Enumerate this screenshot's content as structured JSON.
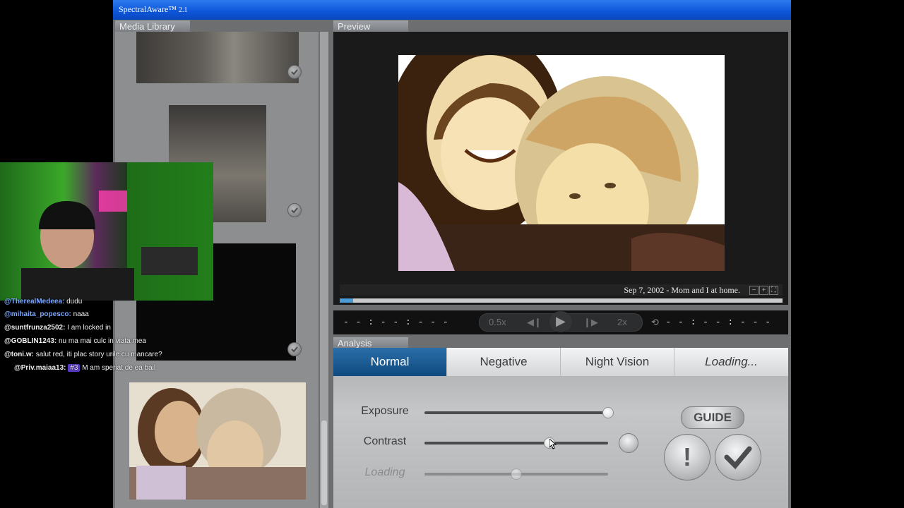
{
  "app": {
    "title": "SpectralAware™",
    "version": "2.1"
  },
  "panels": {
    "library": "Media Library",
    "preview": "Preview",
    "analysis": "Analysis"
  },
  "preview": {
    "caption": "Sep 7, 2002 - Mom and I at home.",
    "time_left": "- - : - - : - - -",
    "time_right": "- - : - - : - - -",
    "speed_slow": "0.5x",
    "speed_fast": "2x",
    "progress_fraction": 0.03
  },
  "analysis": {
    "tabs": [
      {
        "label": "Normal"
      },
      {
        "label": "Negative"
      },
      {
        "label": "Night Vision"
      },
      {
        "label": "Loading..."
      }
    ],
    "sliders": [
      {
        "label": "Exposure",
        "value": 1.0
      },
      {
        "label": "Contrast",
        "value": 0.68
      },
      {
        "label": "Loading",
        "value": 0.5
      }
    ],
    "guide": "GUIDE"
  },
  "chat": [
    {
      "user": "@TherealMedeea:",
      "msg": "dudu",
      "color": "#7da7ff"
    },
    {
      "user": "@mihaita_popesco:",
      "msg": "naaa",
      "color": "#7da7ff"
    },
    {
      "user": "@suntfrunza2502:",
      "msg": "I am locked in",
      "color": "#ffffff"
    },
    {
      "user": "@GOBLIN1243:",
      "msg": "nu ma mai culc in viata mea",
      "color": "#ffffff"
    },
    {
      "user": "@toni.w:",
      "msg": "salut red, iti plac story urile cu mancare?",
      "color": "#ffffff"
    },
    {
      "user": "@Priv.maiaa13:",
      "msg": "M am speriat de ea bail",
      "color": "#ffffff",
      "badge": "#3"
    }
  ]
}
